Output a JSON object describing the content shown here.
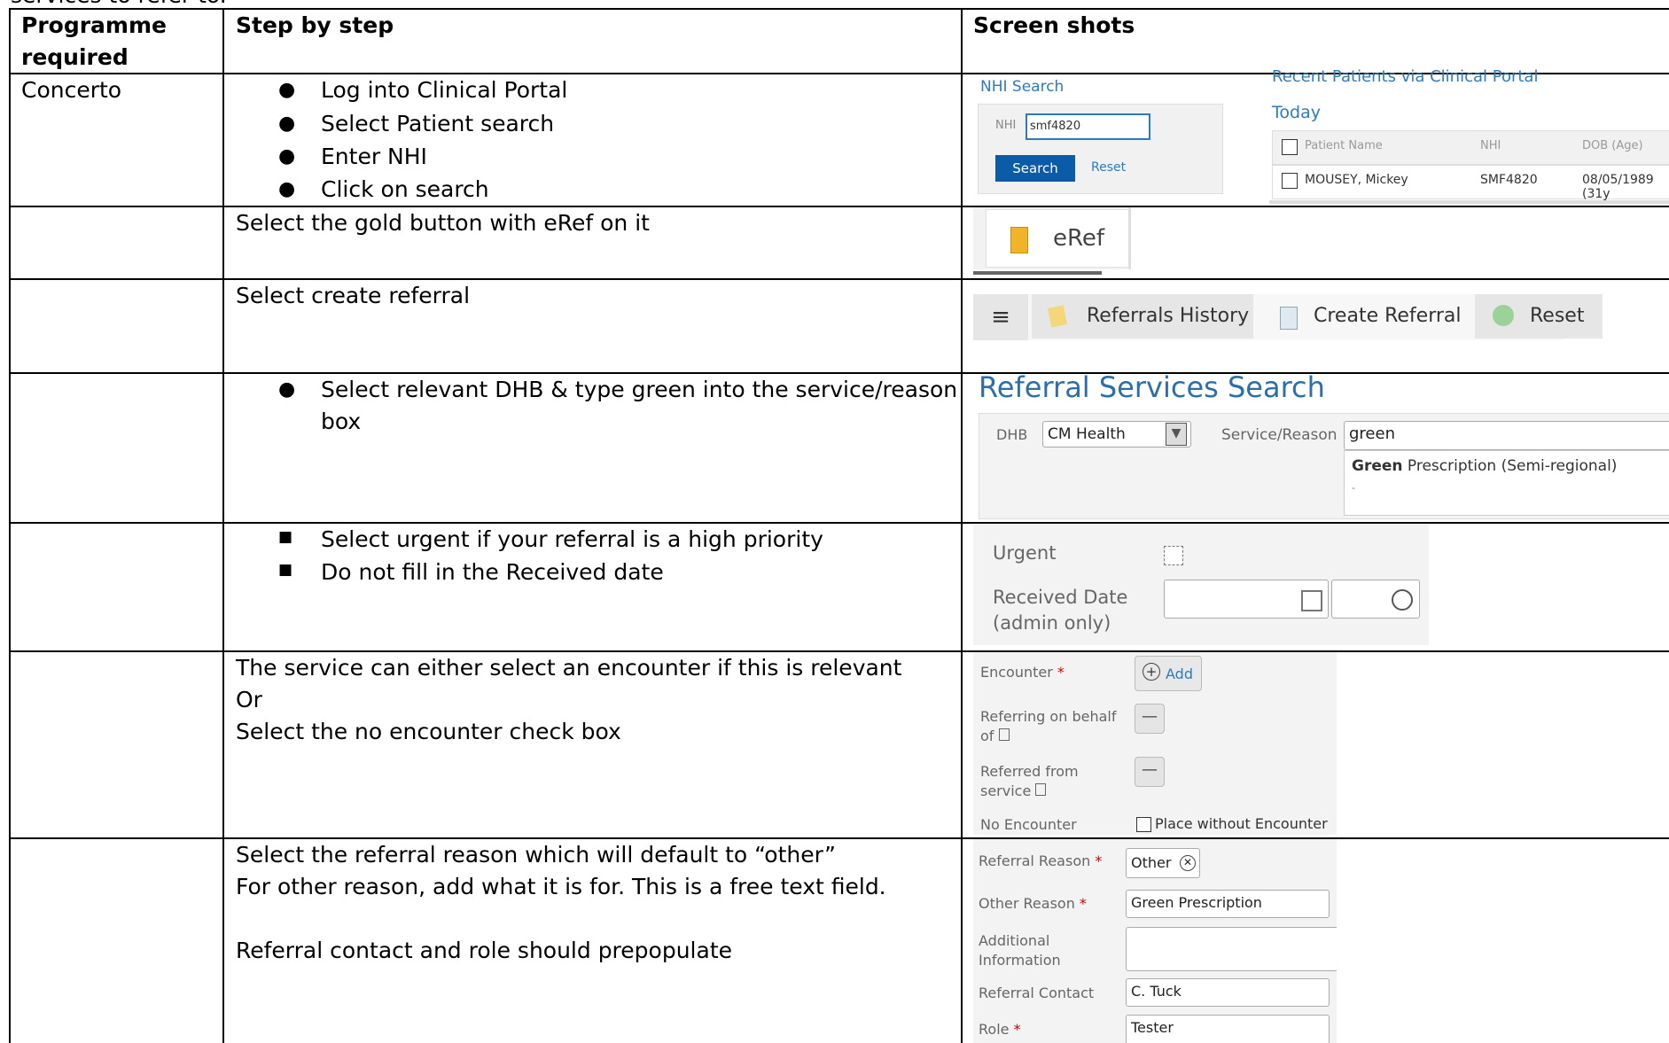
{
  "intro_cutoff": "services to refer to.",
  "headers": {
    "col1": "Programme required",
    "col1a": "Programme",
    "col1b": "required",
    "col2": "Step by step",
    "col3": "Screen shots"
  },
  "row1": {
    "programme": "Concerto",
    "steps": [
      "Log into Clinical Portal",
      "Select Patient search",
      "Enter NHI",
      "Click on search"
    ],
    "shot": {
      "nhi_title": "NHI Search",
      "nhi_label": "NHI",
      "nhi_value": "smf4820",
      "search_btn": "Search",
      "reset_link": "Reset",
      "recent_title": "Recent Patients via Clinical Portal",
      "today": "Today",
      "columns": [
        "Patient Name",
        "NHI",
        "DOB (Age)"
      ],
      "row": [
        "MOUSEY, Mickey",
        "SMF4820",
        "08/05/1989 (31y"
      ]
    }
  },
  "row2": {
    "step": "Select the gold button with eRef on it",
    "shot": {
      "button": "eRef"
    }
  },
  "row3": {
    "step": "Select create referral",
    "shot": {
      "tabs": [
        "Referrals History",
        "Create Referral",
        "Reset"
      ]
    }
  },
  "row4": {
    "step_l1": "Select relevant DHB & type green into the service/reason",
    "step_l2": "box",
    "shot": {
      "title": "Referral Services Search",
      "dhb_label": "DHB",
      "dhb_value": "CM Health",
      "service_label": "Service/Reason",
      "service_value": "green",
      "suggest_bold": "Green",
      "suggest_rest": " Prescription (Semi-regional)",
      "suggest_dash": "-"
    }
  },
  "row5": {
    "steps": [
      "Select urgent if your referral  is a high priority",
      "Do not fill in the Received date"
    ],
    "shot": {
      "urgent": "Urgent",
      "received1": "Received Date",
      "received2": "(admin only)"
    }
  },
  "row6": {
    "lines": [
      "The service can either select an encounter if this is relevant",
      "Or",
      "Select the no encounter check box"
    ],
    "shot": {
      "encounter": "Encounter",
      "req": "*",
      "add": "Add",
      "behalf1": "Referring on behalf",
      "behalf2": "of",
      "from1": "Referred from",
      "from2": "service",
      "noenc": "No Encounter",
      "place": "Place without Encounter"
    }
  },
  "row7": {
    "lines": [
      "Select the referral reason which will default to “other”",
      "For other reason, add what it is for. This is a free text field.",
      "Referral contact and role should prepopulate"
    ],
    "shot": {
      "reason": "Referral Reason",
      "reason_value": "Other",
      "other": "Other Reason",
      "other_value": "Green Prescription",
      "addl1": "Additional",
      "addl2": "Information",
      "contact": "Referral Contact",
      "contact_value": "C. Tuck",
      "role": "Role",
      "role_value": "Tester",
      "req": "*"
    }
  }
}
